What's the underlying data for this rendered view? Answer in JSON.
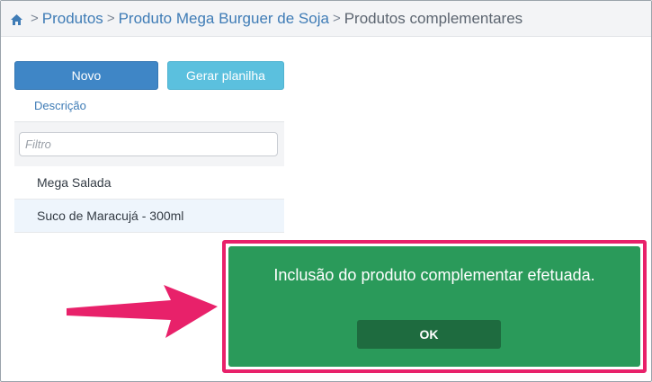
{
  "breadcrumb": {
    "items": [
      "Produtos",
      "Produto Mega Burguer de Soja"
    ],
    "current": "Produtos complementares",
    "separator": ">"
  },
  "toolbar": {
    "novo_label": "Novo",
    "planilha_label": "Gerar planilha"
  },
  "table": {
    "column_header": "Descrição",
    "filter_placeholder": "Filtro",
    "rows": [
      "Mega Salada",
      "Suco de Maracujá - 300ml"
    ]
  },
  "dialog": {
    "message": "Inclusão do produto complementar efetuada.",
    "ok_label": "OK"
  },
  "colors": {
    "primary": "#3f86c6",
    "info": "#5bc0de",
    "success": "#2a9a5a",
    "highlight": "#e8216a"
  }
}
